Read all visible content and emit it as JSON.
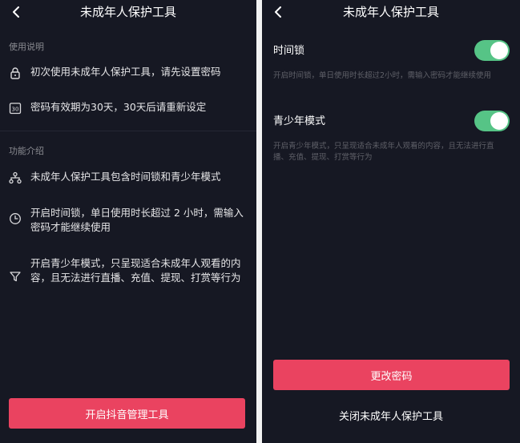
{
  "left_screen": {
    "title": "未成年人保护工具",
    "sections": [
      {
        "title": "使用说明",
        "items": [
          {
            "icon": "lock-icon",
            "text": "初次使用未成年人保护工具，请先设置密码"
          },
          {
            "icon": "calendar-30-icon",
            "text": "密码有效期为30天，30天后请重新设定",
            "icon_text": "30"
          }
        ]
      },
      {
        "title": "功能介绍",
        "items": [
          {
            "icon": "hierarchy-icon",
            "text": "未成年人保护工具包含时间锁和青少年模式"
          },
          {
            "icon": "clock-icon",
            "text": "开启时间锁，单日使用时长超过 2 小时，需输入密码才能继续使用"
          },
          {
            "icon": "filter-icon",
            "text": "开启青少年模式，只呈现适合未成年人观看的内容，且无法进行直播、充值、提现、打赏等行为"
          }
        ]
      }
    ],
    "bottom_button": "开启抖音管理工具"
  },
  "right_screen": {
    "title": "未成年人保护工具",
    "settings": [
      {
        "label": "时间锁",
        "description": "开启时间锁，单日使用时长超过2小时，需输入密码才能继续使用",
        "enabled": true
      },
      {
        "label": "青少年模式",
        "description": "开启青少年模式，只呈现适合未成年人观看的内容，且无法进行直播、充值、提现、打赏等行为",
        "enabled": true
      }
    ],
    "change_password_button": "更改密码",
    "close_link": "关闭未成年人保护工具"
  },
  "colors": {
    "background": "#161823",
    "accent": "#ea4360",
    "toggle_on": "#56c486",
    "muted_text": "#8a8b91"
  }
}
